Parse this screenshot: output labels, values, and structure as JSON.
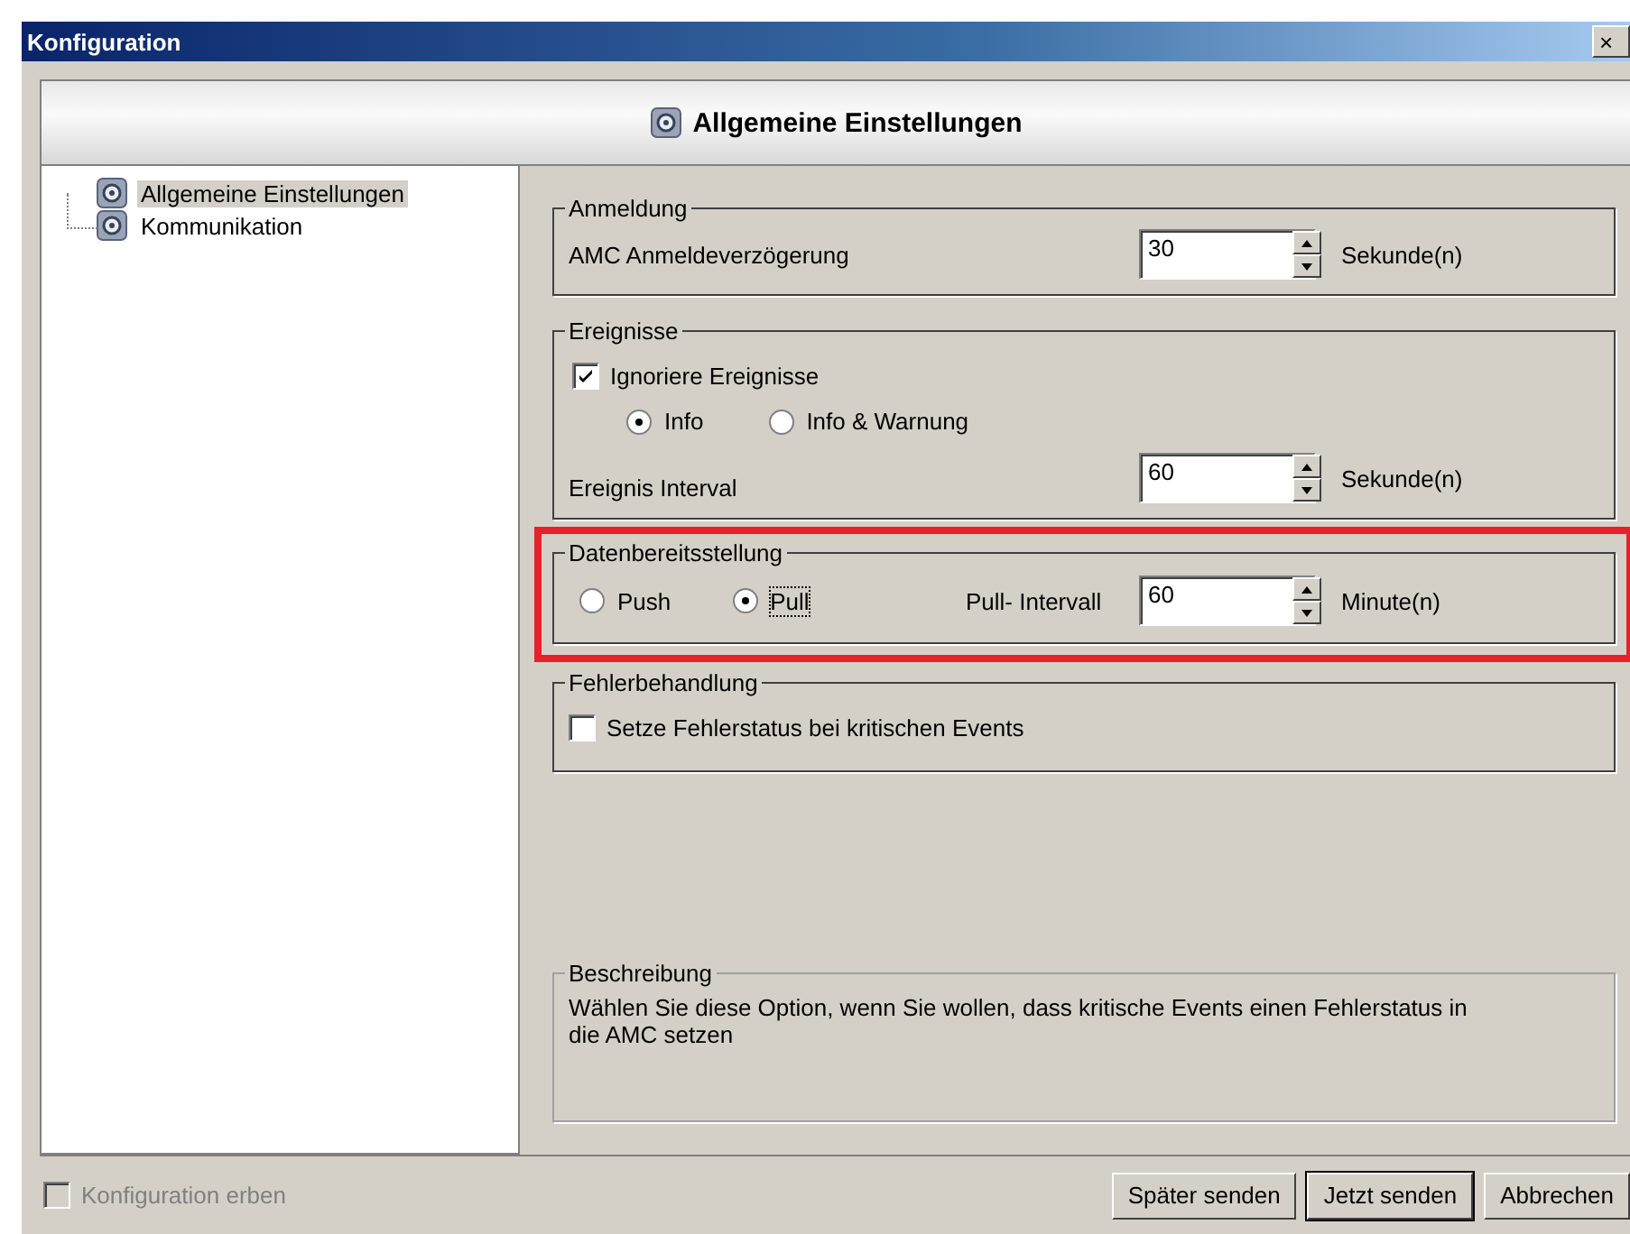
{
  "window": {
    "title": "Konfiguration",
    "close": "×"
  },
  "header": {
    "title": "Allgemeine Einstellungen"
  },
  "tree": {
    "items": [
      {
        "label": "Allgemeine Einstellungen",
        "selected": true
      },
      {
        "label": "Kommunikation",
        "selected": false
      }
    ]
  },
  "login": {
    "legend": "Anmeldung",
    "label": "AMC Anmeldeverzögerung",
    "value": "30",
    "unit": "Sekunde(n)"
  },
  "events": {
    "legend": "Ereignisse",
    "checkbox": {
      "label": "Ignoriere Ereignisse",
      "checked": true
    },
    "radios": [
      {
        "label": "Info",
        "selected": true
      },
      {
        "label": "Info & Warnung",
        "selected": false
      }
    ],
    "interval": {
      "label": "Ereignis Interval",
      "value": "60",
      "unit": "Sekunde(n)"
    }
  },
  "data_provision": {
    "legend": "Datenbereitsstellung",
    "highlighted": true,
    "radios": [
      {
        "label": "Push",
        "selected": false,
        "focused": false
      },
      {
        "label": "Pull",
        "selected": true,
        "focused": true
      }
    ],
    "interval": {
      "label": "Pull- Intervall",
      "value": "60",
      "unit": "Minute(n)"
    }
  },
  "error_handling": {
    "legend": "Fehlerbehandlung",
    "checkbox": {
      "label": "Setze Fehlerstatus bei kritischen Events",
      "checked": false
    }
  },
  "description": {
    "legend": "Beschreibung",
    "text": "Wählen Sie diese Option, wenn Sie wollen, dass kritische Events einen Fehlerstatus in die AMC setzen"
  },
  "footer": {
    "inherit": {
      "label": "Konfiguration erben",
      "checked": false,
      "disabled": true
    },
    "buttons": [
      {
        "label": "Später senden",
        "default": false
      },
      {
        "label": "Jetzt senden",
        "default": true
      },
      {
        "label": "Abbrechen",
        "default": false
      }
    ]
  }
}
